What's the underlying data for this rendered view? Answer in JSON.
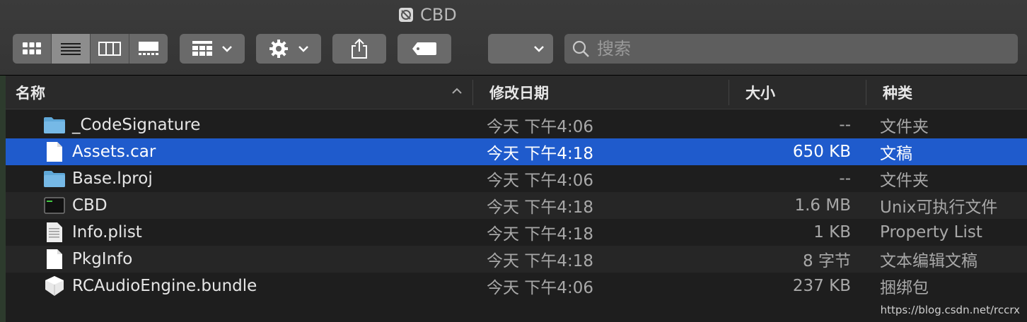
{
  "window": {
    "title": "CBD"
  },
  "toolbar": {
    "view_buttons": [
      "icon-view",
      "list-view",
      "column-view",
      "gallery-view"
    ],
    "search_placeholder": "搜索"
  },
  "columns": {
    "name": "名称",
    "date": "修改日期",
    "size": "大小",
    "kind": "种类"
  },
  "files": [
    {
      "name": "_CodeSignature",
      "date": "今天 下午4:06",
      "size": "--",
      "kind": "文件夹",
      "icon": "folder-icon"
    },
    {
      "name": "Assets.car",
      "date": "今天 下午4:18",
      "size": "650 KB",
      "kind": "文稿",
      "icon": "document-icon",
      "selected": true
    },
    {
      "name": "Base.lproj",
      "date": "今天 下午4:06",
      "size": "--",
      "kind": "文件夹",
      "icon": "folder-icon"
    },
    {
      "name": "CBD",
      "date": "今天 下午4:18",
      "size": "1.6 MB",
      "kind": "Unix可执行文件",
      "icon": "terminal-exec-icon"
    },
    {
      "name": "Info.plist",
      "date": "今天 下午4:18",
      "size": "1 KB",
      "kind": "Property List",
      "icon": "plist-icon"
    },
    {
      "name": "PkgInfo",
      "date": "今天 下午4:18",
      "size": "8 字节",
      "kind": "文本编辑文稿",
      "icon": "document-icon"
    },
    {
      "name": "RCAudioEngine.bundle",
      "date": "今天 下午4:06",
      "size": "237 KB",
      "kind": "捆绑包",
      "icon": "bundle-icon"
    }
  ],
  "watermark": "https://blog.csdn.net/rccrx"
}
